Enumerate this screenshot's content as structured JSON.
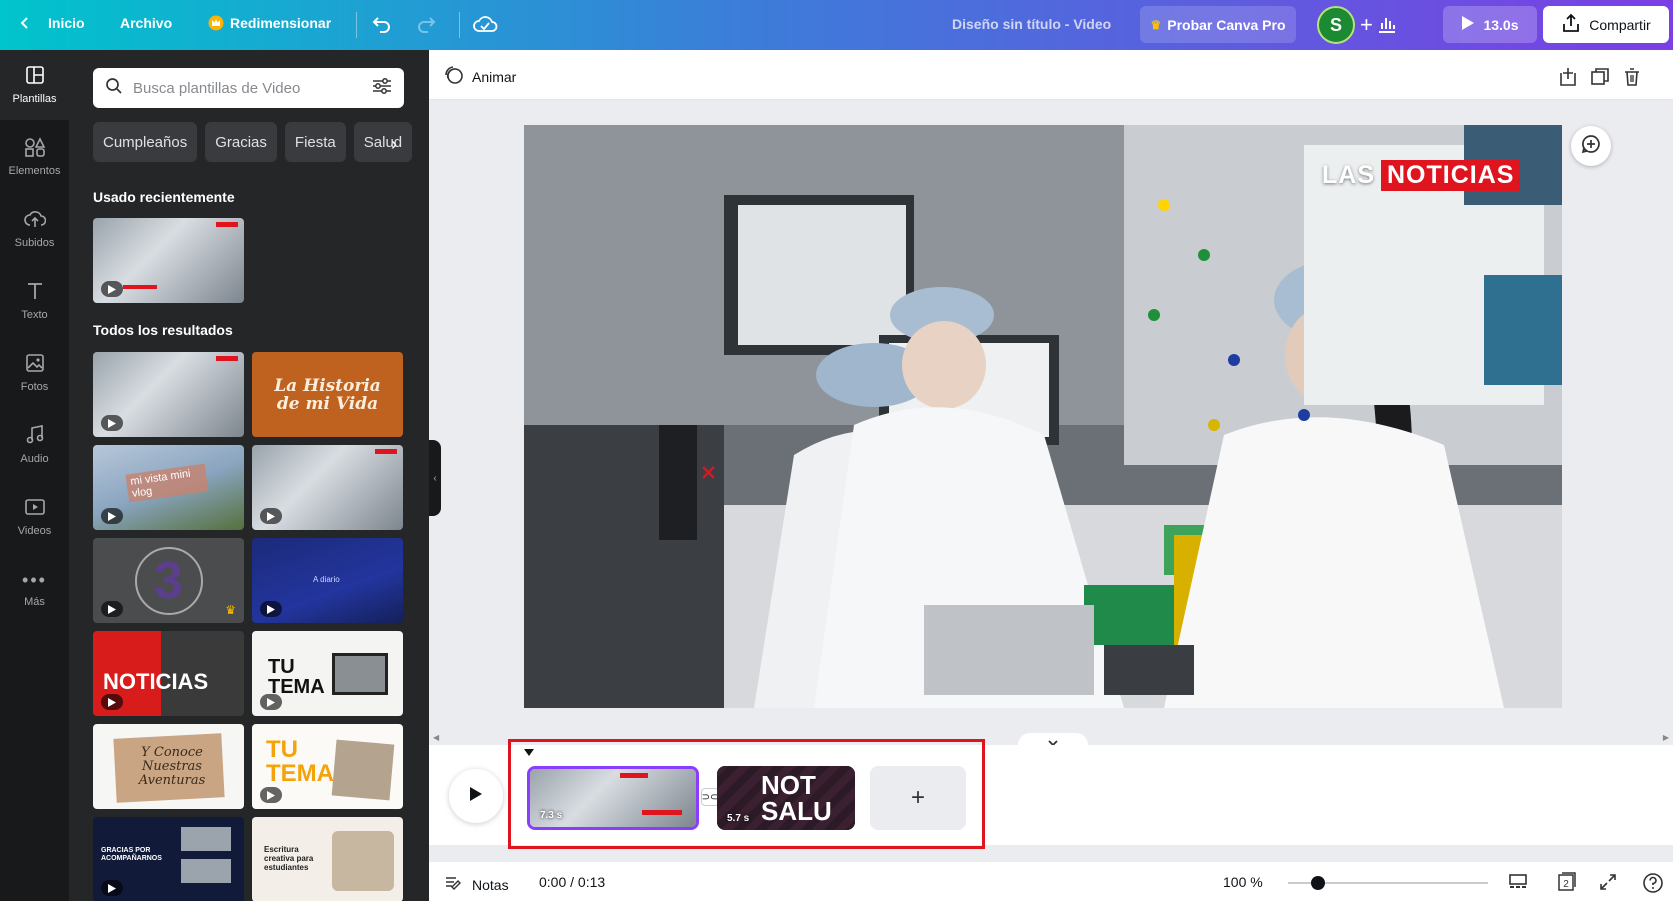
{
  "topbar": {
    "home": "Inicio",
    "file": "Archivo",
    "resize": "Redimensionar",
    "title": "Diseño sin título - Video",
    "try_pro": "Probar Canva Pro",
    "avatar_initial": "S",
    "play_duration": "13.0s",
    "share": "Compartir"
  },
  "rail": [
    {
      "label": "Plantillas",
      "icon": "template-icon"
    },
    {
      "label": "Elementos",
      "icon": "elements-icon"
    },
    {
      "label": "Subidos",
      "icon": "upload-icon"
    },
    {
      "label": "Texto",
      "icon": "text-icon"
    },
    {
      "label": "Fotos",
      "icon": "photo-icon"
    },
    {
      "label": "Audio",
      "icon": "audio-icon"
    },
    {
      "label": "Videos",
      "icon": "video-icon"
    },
    {
      "label": "Más",
      "icon": "more-icon"
    }
  ],
  "panel": {
    "search_placeholder": "Busca plantillas de Video",
    "chips": [
      "Cumpleaños",
      "Gracias",
      "Fiesta",
      "Salud"
    ],
    "recent_heading": "Usado recientemente",
    "all_heading": "Todos los resultados",
    "thumb_texts": {
      "historia": "La Historia de mi Vida",
      "vlog": "mi vista mini vlog",
      "countdown": "3",
      "diario": "A diario",
      "noticias": "NOTICIAS",
      "tema": "TU TEMA",
      "aventuras": "Y Conoce Nuestras Aventuras",
      "tema2": "TU TEMA",
      "gracias": "GRACIAS POR ACOMPAÑARNOS",
      "escritura": "Escritura creativa para estudiantes"
    }
  },
  "editor": {
    "animate": "Animar",
    "headline_a": "LAS",
    "headline_b": "NOTICIAS"
  },
  "timeline": {
    "clips": [
      {
        "duration": "7.3 s"
      },
      {
        "duration": "5.7 s",
        "text": "NOT SALU"
      }
    ],
    "add": "+"
  },
  "footer": {
    "notes": "Notas",
    "time": "0:00 / 0:13",
    "zoom": "100 %",
    "zoom_level": 0.15,
    "pages": "2"
  },
  "colors": {
    "accent_red": "#e0141f",
    "gradient_start": "#00c4cc",
    "gradient_end": "#7b3fe4"
  }
}
